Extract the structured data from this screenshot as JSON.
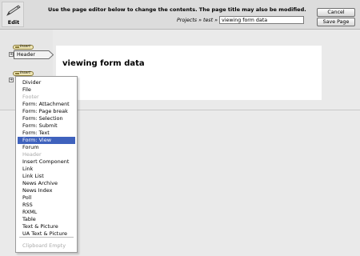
{
  "toolbar": {
    "edit_label": "Edit",
    "instructions": "Use the page editor below to change the contents. The page title may also be modified.",
    "breadcrumb": {
      "projects": "Projects",
      "separator": "»",
      "section": "test"
    },
    "page_title_value": "viewing form data",
    "cancel_label": "Cancel",
    "save_label": "Save Page"
  },
  "editor": {
    "insert_label": "Insert",
    "header_label": "Header",
    "page_heading": "viewing form data"
  },
  "menu": {
    "items": [
      {
        "label": "Divider",
        "disabled": false,
        "selected": false
      },
      {
        "label": "File",
        "disabled": false,
        "selected": false
      },
      {
        "label": "Footer",
        "disabled": true,
        "selected": false
      },
      {
        "label": "Form: Attachment",
        "disabled": false,
        "selected": false
      },
      {
        "label": "Form: Page break",
        "disabled": false,
        "selected": false
      },
      {
        "label": "Form: Selection",
        "disabled": false,
        "selected": false
      },
      {
        "label": "Form: Submit",
        "disabled": false,
        "selected": false
      },
      {
        "label": "Form: Text",
        "disabled": false,
        "selected": false
      },
      {
        "label": "Form: View",
        "disabled": false,
        "selected": true
      },
      {
        "label": "Forum",
        "disabled": false,
        "selected": false
      },
      {
        "label": "Header",
        "disabled": true,
        "selected": false
      },
      {
        "label": "Insert Component",
        "disabled": false,
        "selected": false
      },
      {
        "label": "Link",
        "disabled": false,
        "selected": false
      },
      {
        "label": "Link List",
        "disabled": false,
        "selected": false
      },
      {
        "label": "News Archive",
        "disabled": false,
        "selected": false
      },
      {
        "label": "News Index",
        "disabled": false,
        "selected": false
      },
      {
        "label": "Poll",
        "disabled": false,
        "selected": false
      },
      {
        "label": "RSS",
        "disabled": false,
        "selected": false
      },
      {
        "label": "RXML",
        "disabled": false,
        "selected": false
      },
      {
        "label": "Table",
        "disabled": false,
        "selected": false
      },
      {
        "label": "Text & Picture",
        "disabled": false,
        "selected": false
      },
      {
        "label": "UA Text & Picture",
        "disabled": false,
        "selected": false
      }
    ],
    "clipboard_label": "Clipboard Empty"
  },
  "colors": {
    "selection": "#3f62bd",
    "disabled_text": "#a9a9a9",
    "toolbar_bg": "#dcdcdc",
    "page_bg": "#eaeaea"
  }
}
